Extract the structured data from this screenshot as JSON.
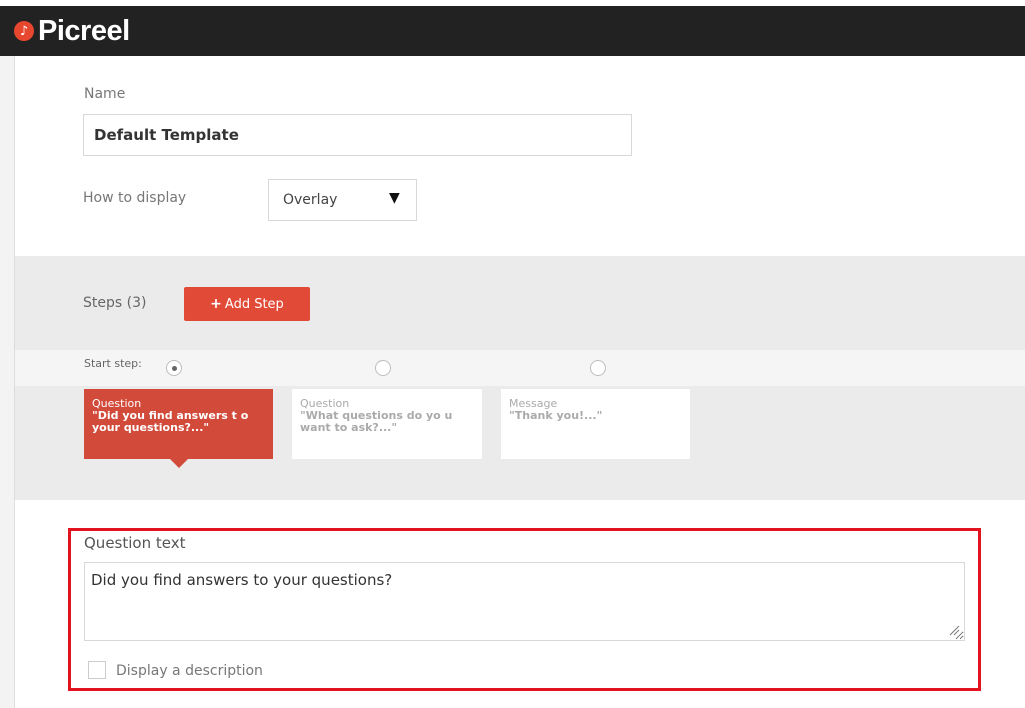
{
  "app": {
    "name": "Picreel",
    "logo_glyph": "♪",
    "brand_color": "#e24a38",
    "topbar_color": "#222222"
  },
  "form": {
    "name_label": "Name",
    "name_value": "Default Template",
    "display_label": "How to display",
    "display_value": "Overlay",
    "display_arrow": "▼"
  },
  "steps": {
    "label": "Steps (3)",
    "add_label": "Add Step",
    "add_icon": "+",
    "start_label": "Start step:",
    "items": [
      {
        "type": "Question",
        "text": "\"Did you find answers t o your questions?...\"",
        "active": true,
        "start": true
      },
      {
        "type": "Question",
        "text": "\"What questions do yo u want to ask?...\"",
        "active": false,
        "start": false
      },
      {
        "type": "Message",
        "text": "\"Thank you!...\"",
        "active": false,
        "start": false
      }
    ]
  },
  "question": {
    "label": "Question text",
    "value": "Did you find answers to your questions?",
    "description_label": "Display a description",
    "description_checked": false,
    "highlight_color": "#e2131e"
  }
}
